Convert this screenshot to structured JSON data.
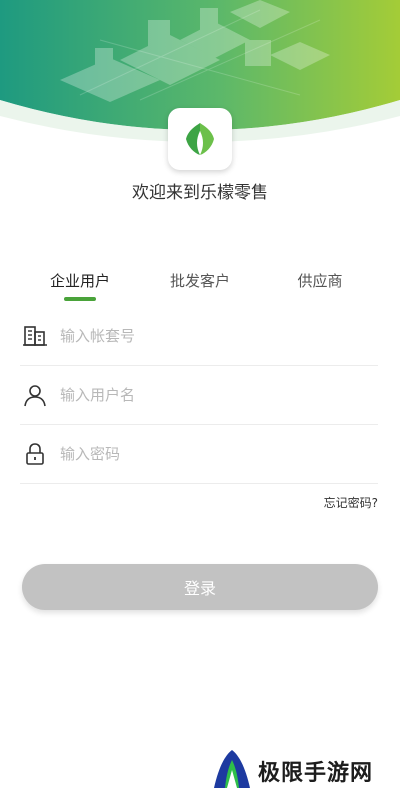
{
  "welcome_text": "欢迎来到乐檬零售",
  "tabs": [
    {
      "label": "企业用户",
      "active": true
    },
    {
      "label": "批发客户",
      "active": false
    },
    {
      "label": "供应商",
      "active": false
    }
  ],
  "form": {
    "account_placeholder": "输入帐套号",
    "username_placeholder": "输入用户名",
    "password_placeholder": "输入密码"
  },
  "forgot_label": "忘记密码?",
  "login_label": "登录",
  "watermark_text": "极限手游网",
  "colors": {
    "accent": "#4aa33a",
    "button_disabled": "#c2c2c2"
  }
}
